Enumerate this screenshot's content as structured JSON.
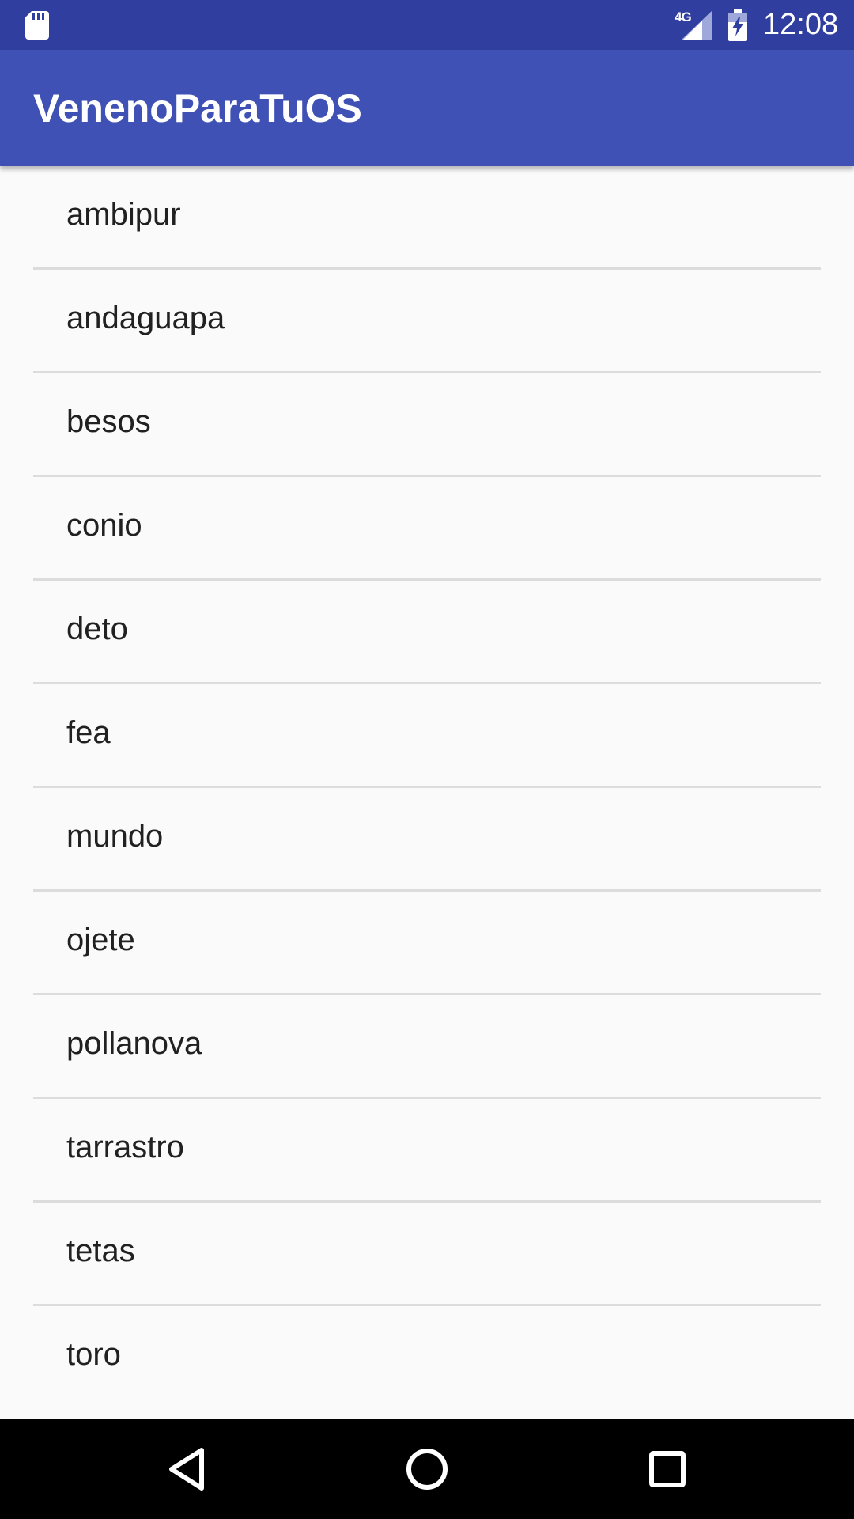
{
  "status_bar": {
    "network": "4G",
    "time": "12:08",
    "icons": [
      "sd-card-icon",
      "signal-icon",
      "battery-charging-icon"
    ]
  },
  "app_bar": {
    "title": "VenenoParaTuOS"
  },
  "list": {
    "items": [
      {
        "label": "ambipur"
      },
      {
        "label": "andaguapa"
      },
      {
        "label": "besos"
      },
      {
        "label": "conio"
      },
      {
        "label": "deto"
      },
      {
        "label": "fea"
      },
      {
        "label": "mundo"
      },
      {
        "label": "ojete"
      },
      {
        "label": "pollanova"
      },
      {
        "label": "tarrastro"
      },
      {
        "label": "tetas"
      },
      {
        "label": "toro"
      }
    ]
  },
  "nav_bar": {
    "icons": [
      "back-icon",
      "home-icon",
      "recents-icon"
    ]
  },
  "colors": {
    "status_bar": "#303f9f",
    "app_bar": "#3f51b5",
    "background": "#fafafa",
    "divider": "#dcdcdc",
    "text": "#212121",
    "nav_bar": "#000000"
  }
}
